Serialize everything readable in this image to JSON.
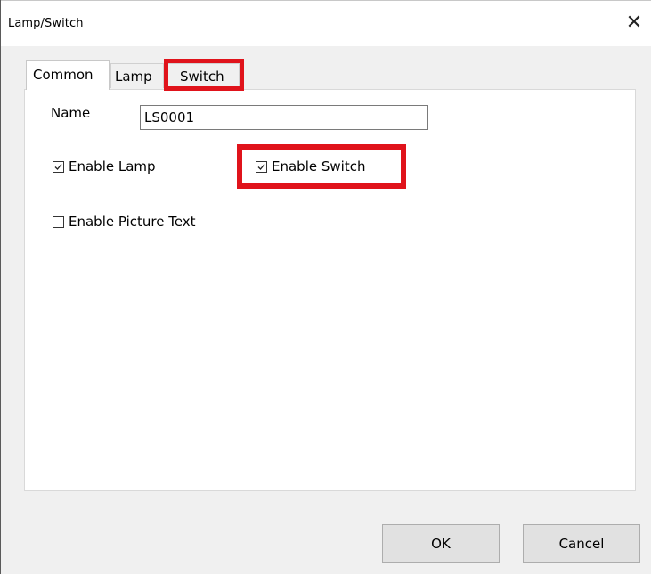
{
  "window": {
    "title": "Lamp/Switch",
    "close_glyph": "✕"
  },
  "tabs": [
    {
      "label": "Common",
      "active": true
    },
    {
      "label": "Lamp",
      "active": false
    },
    {
      "label": "Switch",
      "active": false
    }
  ],
  "common": {
    "name_label": "Name",
    "name_value": "LS0001",
    "enable_lamp": {
      "label": "Enable Lamp",
      "checked": true
    },
    "enable_switch": {
      "label": "Enable Switch",
      "checked": true
    },
    "enable_picture_text": {
      "label": "Enable Picture Text",
      "checked": false
    }
  },
  "buttons": {
    "ok": "OK",
    "cancel": "Cancel"
  },
  "colors": {
    "highlight": "#e0131b"
  }
}
